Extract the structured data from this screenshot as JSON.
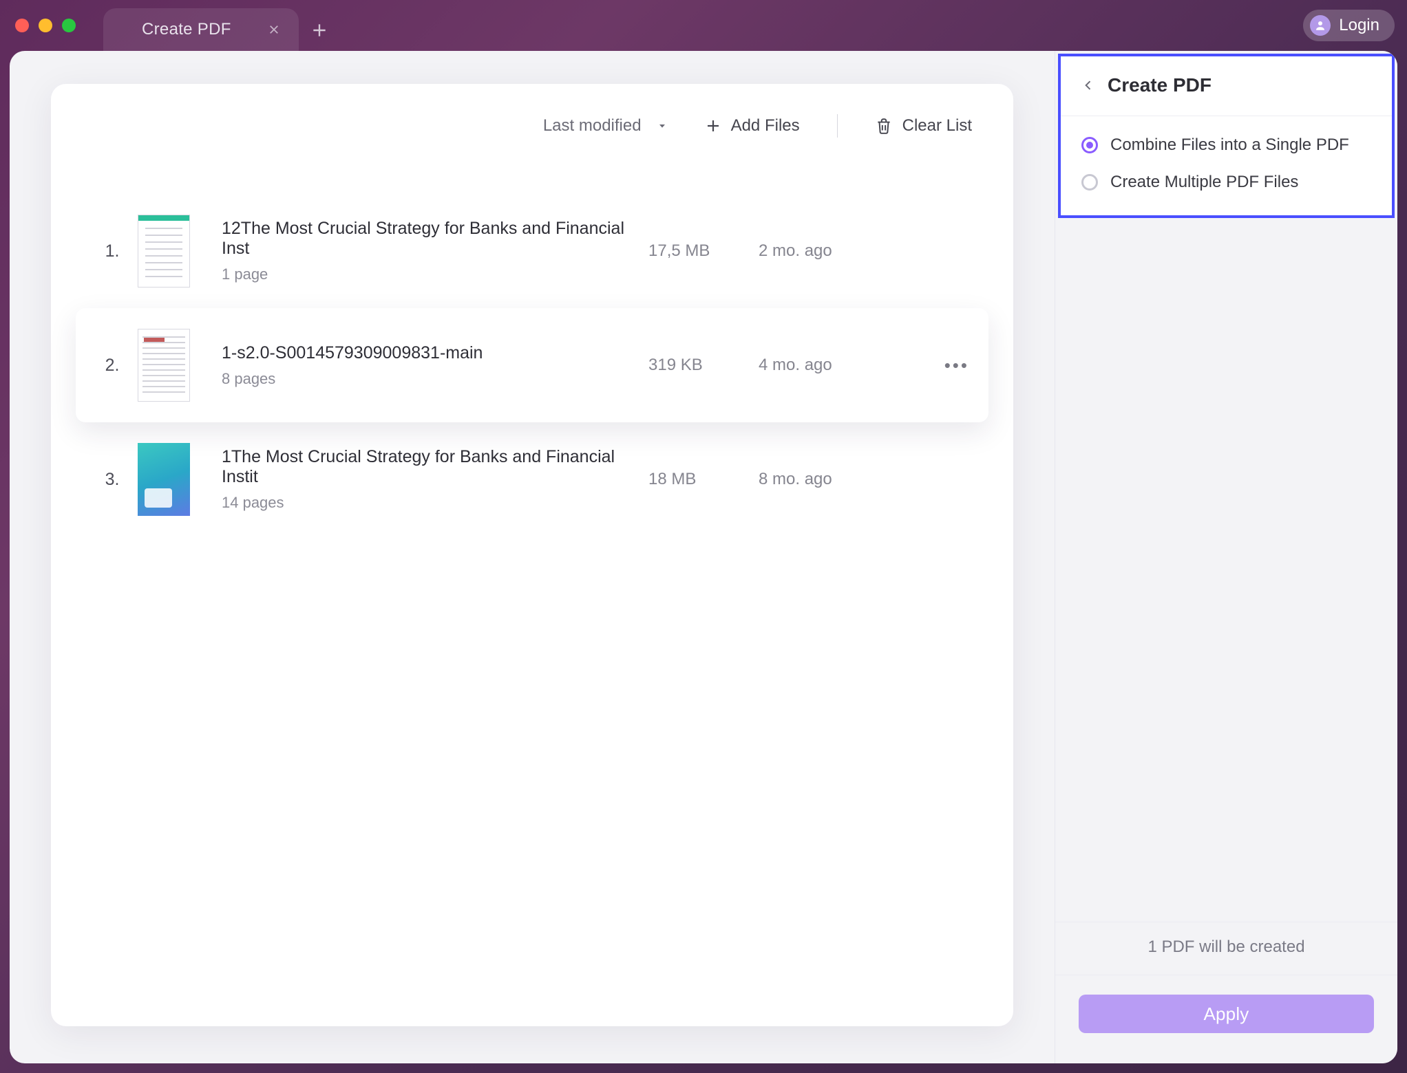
{
  "window": {
    "tab_title": "Create PDF",
    "login_label": "Login"
  },
  "toolbar": {
    "sort_label": "Last modified",
    "add_files_label": "Add Files",
    "clear_list_label": "Clear List"
  },
  "files": [
    {
      "index": "1.",
      "title": "12The Most Crucial Strategy for Banks and Financial Inst",
      "pages": "1 page",
      "size": "17,5 MB",
      "modified": "2 mo. ago",
      "thumb": "doc",
      "selected": false
    },
    {
      "index": "2.",
      "title": "1-s2.0-S0014579309009831-main",
      "pages": "8 pages",
      "size": "319 KB",
      "modified": "4 mo. ago",
      "thumb": "paper",
      "selected": true
    },
    {
      "index": "3.",
      "title": "1The Most Crucial Strategy for Banks and Financial Instit",
      "pages": "14 pages",
      "size": "18 MB",
      "modified": "8 mo. ago",
      "thumb": "cover",
      "selected": false
    }
  ],
  "panel": {
    "title": "Create PDF",
    "option_combine": "Combine Files into a Single PDF",
    "option_multiple": "Create Multiple PDF Files",
    "selected_option": "combine",
    "status_text": "1 PDF will be created",
    "apply_label": "Apply"
  },
  "icons": {
    "close": "close",
    "plus": "plus",
    "avatar": "user",
    "caret": "caret-down",
    "trash": "trash",
    "kebab": "more",
    "chev_left": "chevron-left"
  }
}
